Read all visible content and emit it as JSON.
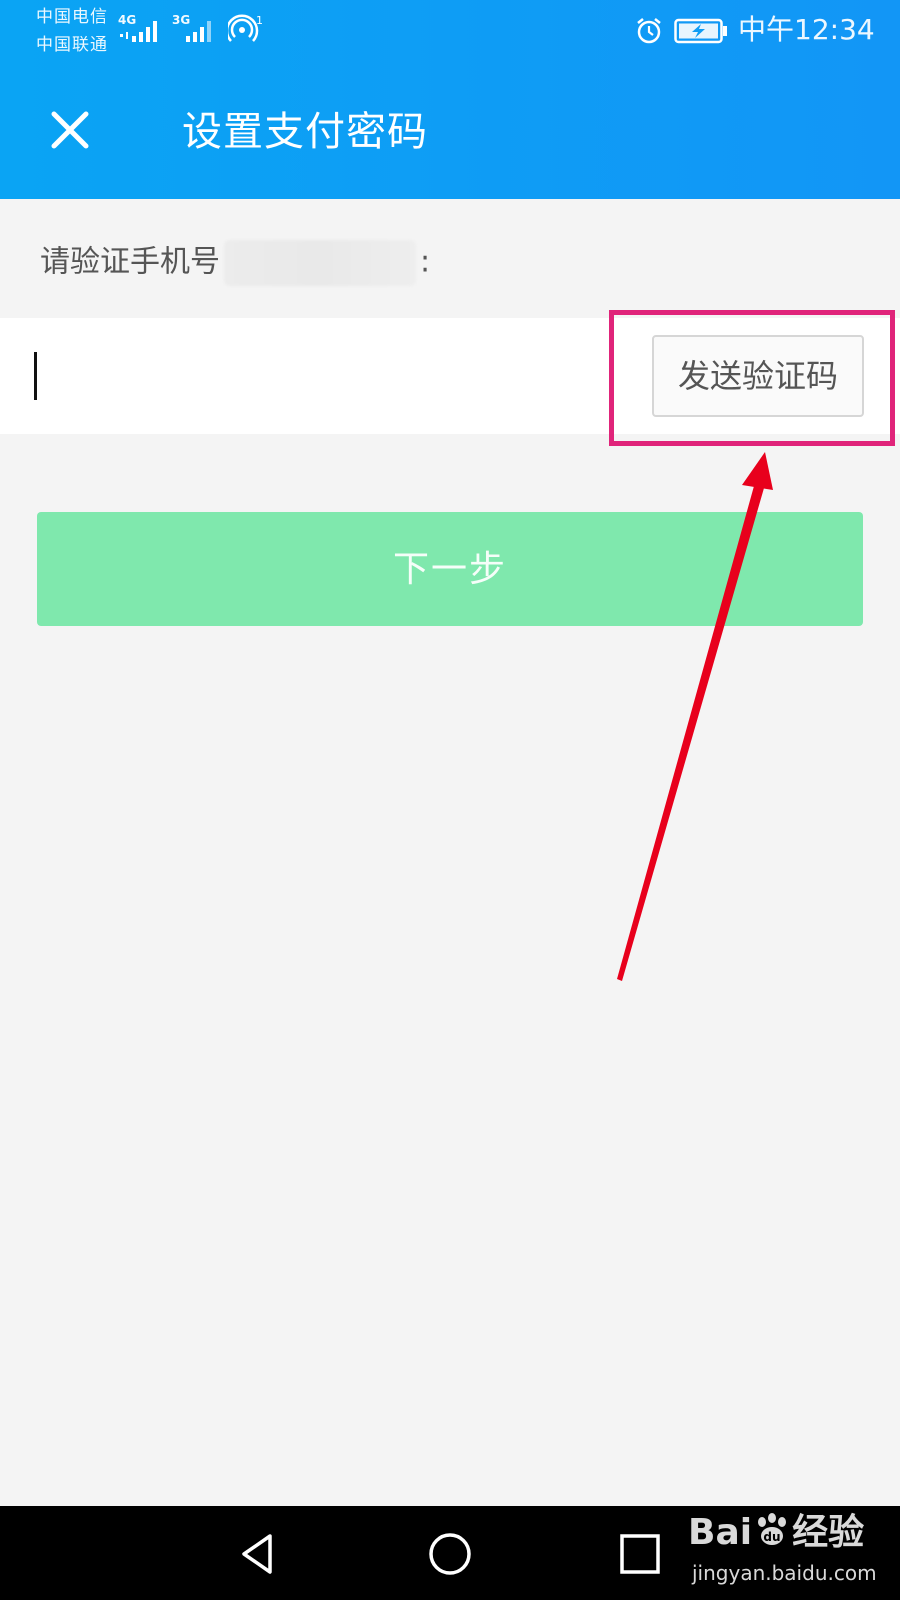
{
  "status_bar": {
    "carrier_1": "中国电信",
    "carrier_2": "中国联通",
    "network_1": "4G",
    "network_2": "3G",
    "hotspot_count": "1",
    "time": "中午12:34",
    "icons": [
      "signal-icon",
      "hotspot-icon",
      "alarm-icon",
      "battery-charging-icon"
    ]
  },
  "header": {
    "title": "设置支付密码",
    "close_icon": "close-icon"
  },
  "form": {
    "verify_label": "请验证手机号",
    "verify_suffix": ":",
    "code_input_value": "",
    "send_code_label": "发送验证码",
    "next_label": "下一步"
  },
  "colors": {
    "header_start": "#0aa4f4",
    "header_end": "#1296f6",
    "next_button": "#7fe8ad",
    "highlight": "#e0247a",
    "arrow": "#e8001c"
  },
  "nav_bar": {
    "icons": [
      "back-icon",
      "home-icon",
      "recent-apps-icon"
    ]
  },
  "watermark": {
    "brand": "Bai",
    "brand_suffix": "经验",
    "url": "jingyan.baidu.com"
  }
}
